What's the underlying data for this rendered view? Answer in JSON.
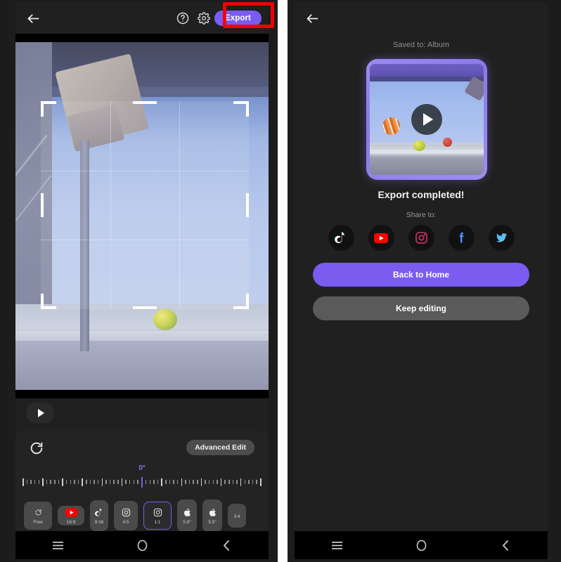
{
  "left_screen": {
    "topbar": {
      "back_icon": "back-arrow-icon",
      "help_icon": "help-circle-icon",
      "settings_icon": "gear-icon",
      "export_label": "Export"
    },
    "preview": {
      "play_icon": "play-icon",
      "crop_overlay": "crop-frame"
    },
    "edit_panel": {
      "reset_icon": "rotate-reset-icon",
      "advanced_edit_label": "Advanced Edit",
      "rotation_value": "0°"
    },
    "aspect_ratios": [
      {
        "label": "Free",
        "icon": "free-crop-icon",
        "selected": false
      },
      {
        "label": "16:9",
        "icon": "youtube-icon",
        "selected": false
      },
      {
        "label": "9:16",
        "icon": "tiktok-icon",
        "selected": false
      },
      {
        "label": "4:5",
        "icon": "instagram-icon",
        "selected": false
      },
      {
        "label": "1:1",
        "icon": "instagram-icon",
        "selected": true
      },
      {
        "label": "5.8\"",
        "icon": "apple-icon",
        "selected": false
      },
      {
        "label": "5.5\"",
        "icon": "apple-icon",
        "selected": false
      },
      {
        "label": "3:4",
        "icon": "none",
        "selected": false
      }
    ],
    "navbar": {
      "recents_icon": "menu-icon",
      "home_icon": "circle-icon",
      "back_icon": "chevron-left-icon"
    }
  },
  "right_screen": {
    "topbar": {
      "back_icon": "back-arrow-icon"
    },
    "saved_to": "Saved to: Album",
    "thumbnail": {
      "play_icon": "play-icon"
    },
    "completed_text": "Export completed!",
    "share_label": "Share to:",
    "share_targets": [
      {
        "name": "TikTok",
        "icon": "tiktok-icon"
      },
      {
        "name": "YouTube",
        "icon": "youtube-icon"
      },
      {
        "name": "Instagram",
        "icon": "instagram-icon"
      },
      {
        "name": "Facebook",
        "icon": "facebook-icon"
      },
      {
        "name": "Twitter",
        "icon": "twitter-icon"
      }
    ],
    "back_home_label": "Back to Home",
    "keep_editing_label": "Keep editing",
    "navbar": {
      "recents_icon": "menu-icon",
      "home_icon": "circle-icon",
      "back_icon": "chevron-left-icon"
    }
  },
  "annotation": {
    "highlight_color": "#f40000",
    "target": "Export"
  },
  "colors": {
    "accent": "#7b5cf0",
    "panel_bg": "#232323",
    "screen_bg": "#202020"
  }
}
